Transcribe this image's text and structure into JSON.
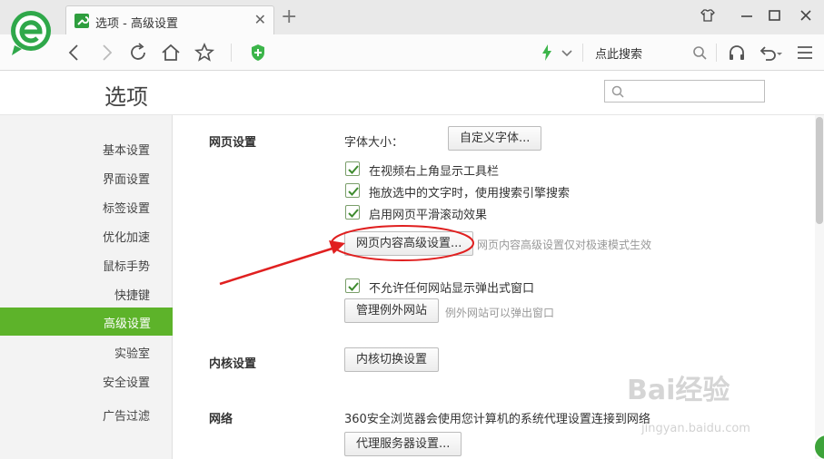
{
  "browser": {
    "tab_title": "选项 - 高级设置",
    "search_text": "点此搜索"
  },
  "options": {
    "title": "选项",
    "search_placeholder": ""
  },
  "sidebar": {
    "items": [
      {
        "label": "基本设置"
      },
      {
        "label": "界面设置"
      },
      {
        "label": "标签设置"
      },
      {
        "label": "优化加速"
      },
      {
        "label": "鼠标手势"
      },
      {
        "label": "快捷键"
      },
      {
        "label": "高级设置"
      },
      {
        "label": "实验室"
      },
      {
        "label": "安全设置"
      },
      {
        "label": "广告过滤"
      }
    ],
    "active_index": 6,
    "active_color": "#5db32a"
  },
  "web_settings": {
    "title": "网页设置",
    "font_size_label": "字体大小：",
    "custom_font_button": "自定义字体...",
    "checkboxes": [
      {
        "label": "在视频右上角显示工具栏",
        "checked": true
      },
      {
        "label": "拖放选中的文字时，使用搜索引擎搜索",
        "checked": true
      },
      {
        "label": "启用网页平滑滚动效果",
        "checked": true
      }
    ],
    "advanced_button": "网页内容高级设置...",
    "advanced_hint": "网页内容高级设置仅对极速模式生效",
    "popup_checkbox": {
      "label": "不允许任何网站显示弹出式窗口",
      "checked": true
    },
    "exception_button": "管理例外网站",
    "exception_hint": "例外网站可以弹出窗口"
  },
  "kernel_settings": {
    "title": "内核设置",
    "switch_button": "内核切换设置"
  },
  "network": {
    "title": "网络",
    "description": "360安全浏览器会使用您计算机的系统代理设置连接到网络",
    "proxy_button": "代理服务器设置..."
  },
  "watermark": {
    "text": "Bai经验",
    "sub": "jingyan.baidu.com"
  },
  "annotation_color": "#e02020"
}
